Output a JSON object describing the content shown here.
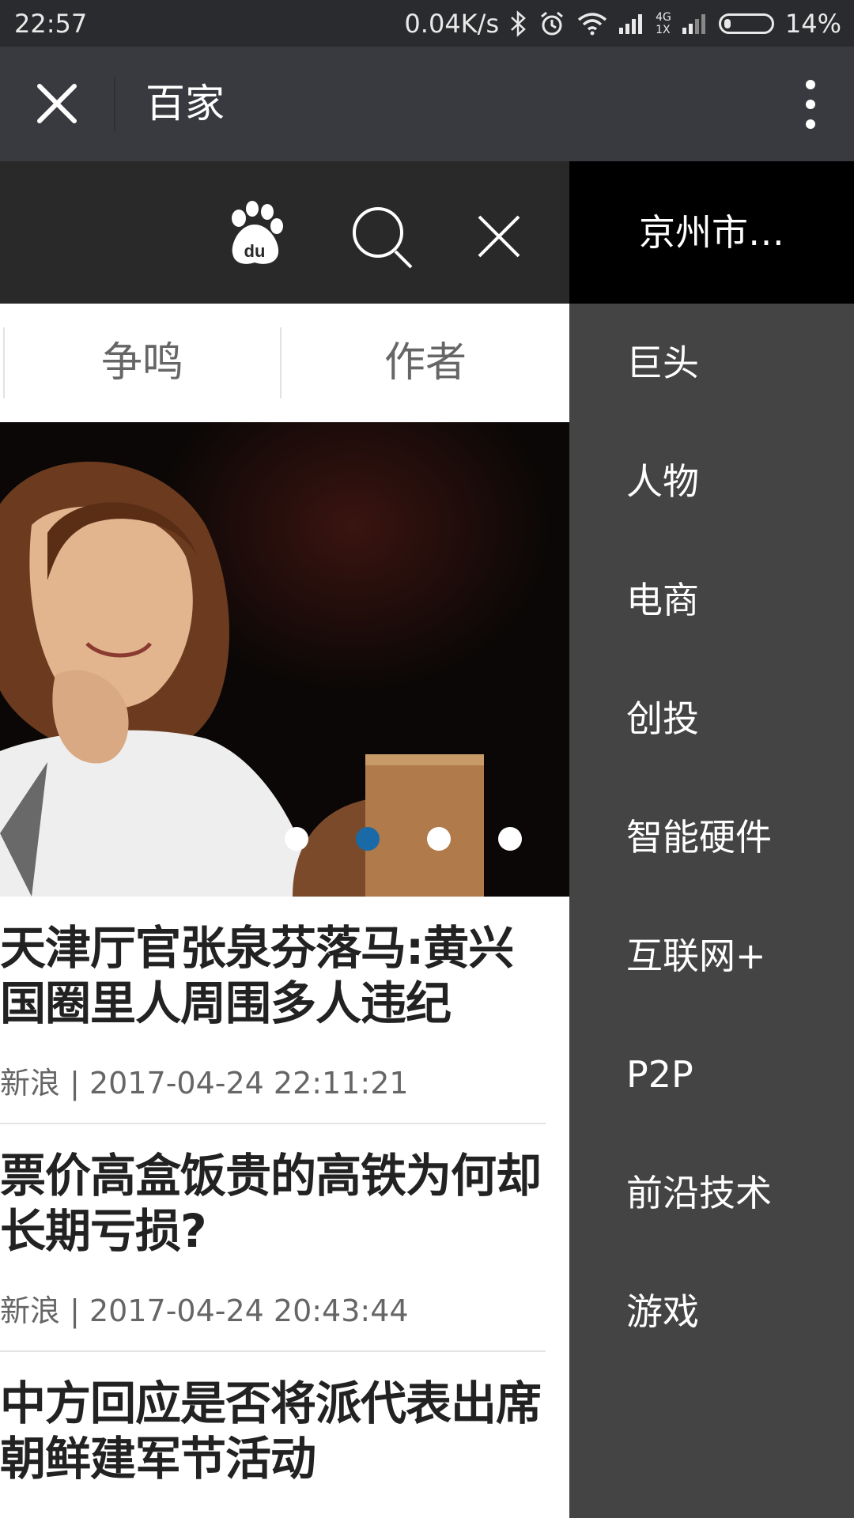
{
  "status_bar": {
    "time": "22:57",
    "network_speed": "0.04K/s",
    "signal_label": "4G",
    "signal_sub": "1X",
    "battery": "14%",
    "battery_level": 0.14
  },
  "title_bar": {
    "title": "百家",
    "close_icon": "close-icon",
    "more_icon": "more-vertical-icon"
  },
  "toolbar": {
    "logo_text": "du",
    "icons": [
      "baidu-paw-icon",
      "search-icon",
      "close-icon"
    ]
  },
  "side_panel": {
    "header": "京州市…",
    "items": [
      "巨头",
      "人物",
      "电商",
      "创投",
      "智能硬件",
      "互联网+",
      "P2P",
      "前沿技术",
      "游戏"
    ]
  },
  "tabs": [
    {
      "label": "争鸣"
    },
    {
      "label": "作者"
    }
  ],
  "carousel": {
    "count": 4,
    "active_index": 1,
    "colors": {
      "active": "#1a6aa8",
      "inactive": "#ffffff"
    }
  },
  "articles": [
    {
      "headline": "天津厅官张泉芬落马:黄兴国圈里人周围多人违纪",
      "source": "新浪",
      "time": "2017-04-24 22:11:21"
    },
    {
      "headline": "票价高盒饭贵的高铁为何却长期亏损?",
      "source": "新浪",
      "time": "2017-04-24 20:43:44"
    },
    {
      "headline": "中方回应是否将派代表出席朝鲜建军节活动",
      "source": "",
      "time": ""
    }
  ]
}
